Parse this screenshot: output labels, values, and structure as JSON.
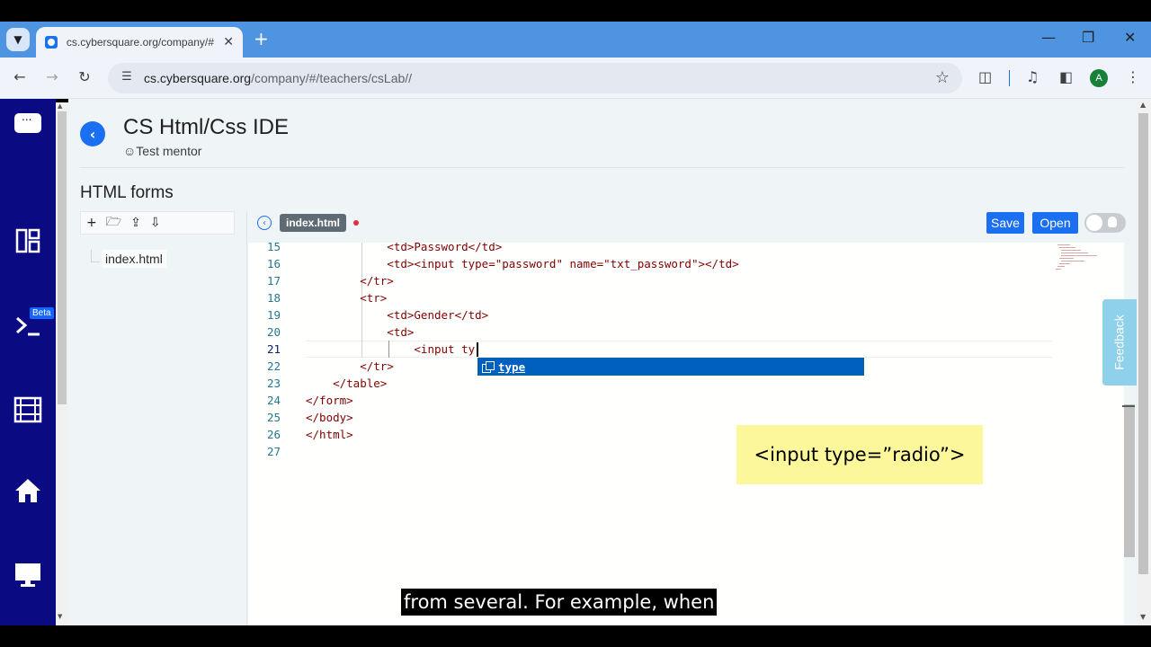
{
  "browser": {
    "tab_title": "cs.cybersquare.org/company/#",
    "url_host": "cs.cybersquare.org",
    "url_path": "/company/#/teachers/csLab//",
    "profile_initial": "A"
  },
  "sidebar": {
    "beta_badge": "Beta",
    "items": [
      "chat-icon",
      "dashboard-icon",
      "terminal-icon",
      "film-icon",
      "home-icon",
      "desktop-icon"
    ]
  },
  "header": {
    "title": "CS Html/Css IDE",
    "mentor": "Test mentor"
  },
  "section_title": "HTML forms",
  "files": [
    "index.html"
  ],
  "editor": {
    "active_tab": "index.html",
    "save_label": "Save",
    "open_label": "Open",
    "active_line": 21,
    "lines": [
      {
        "n": "15",
        "code": "            <td>Password</td>"
      },
      {
        "n": "16",
        "code": "            <td><input type=\"password\" name=\"txt_password\"></td>"
      },
      {
        "n": "17",
        "code": "        </tr>"
      },
      {
        "n": "18",
        "code": "        <tr>"
      },
      {
        "n": "19",
        "code": "            <td>Gender</td>"
      },
      {
        "n": "20",
        "code": "            <td>"
      },
      {
        "n": "21",
        "code": "                <input ty"
      },
      {
        "n": "22",
        "code": "        </tr>"
      },
      {
        "n": "23",
        "code": "    </table>"
      },
      {
        "n": "24",
        "code": "</form>"
      },
      {
        "n": "25",
        "code": "</body>"
      },
      {
        "n": "26",
        "code": "</html>"
      },
      {
        "n": "27",
        "code": ""
      }
    ],
    "suggestion": "type"
  },
  "feedback_label": "Feedback",
  "callout": "<input type=”radio”>",
  "caption": "from several. For example, when",
  "colors": {
    "sidebar": "#0a0a82",
    "accent": "#1a6ff2",
    "tabstrip": "#4f94e0",
    "callout": "#fbf79a"
  }
}
